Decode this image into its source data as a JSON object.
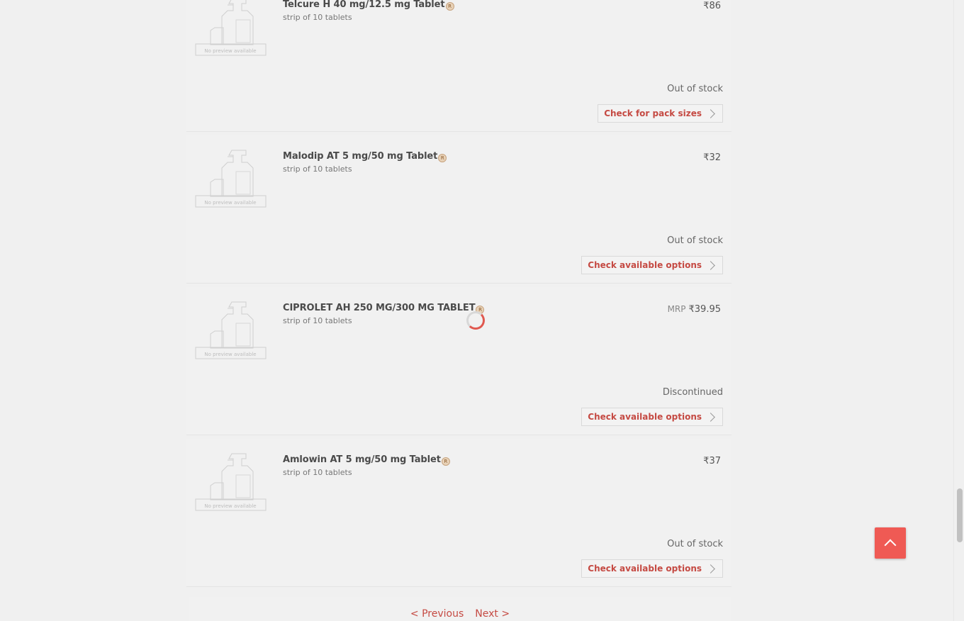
{
  "products": [
    {
      "name": "Telcure H 40 mg/12.5 mg Tablet",
      "pack": "strip of 10 tablets",
      "mrp_label": "",
      "price": "₹86",
      "status": "Out of stock",
      "cta": "Check for pack sizes",
      "thumb_text": "No preview available"
    },
    {
      "name": "Malodip AT 5 mg/50 mg Tablet",
      "pack": "strip of 10 tablets",
      "mrp_label": "",
      "price": "₹32",
      "status": "Out of stock",
      "cta": "Check available options",
      "thumb_text": "No preview available"
    },
    {
      "name": "CIPROLET AH 250 MG/300 MG TABLET",
      "pack": "strip of 10 tablets",
      "mrp_label": "MRP",
      "price": "₹39.95",
      "status": "Discontinued",
      "cta": "Check available options",
      "thumb_text": "No preview available"
    },
    {
      "name": "Amlowin AT 5 mg/50 mg Tablet",
      "pack": "strip of 10 tablets",
      "mrp_label": "",
      "price": "₹37",
      "status": "Out of stock",
      "cta": "Check available options",
      "thumb_text": "No preview available"
    }
  ],
  "rx_badge": "R",
  "pagination": {
    "previous": "< Previous",
    "next": "Next >"
  },
  "colors": {
    "accent": "#c54a43",
    "scroll_top_bg": "#ef5a54"
  },
  "icons": {
    "rx": "rx-icon",
    "chevron": "chevron-right-icon",
    "scroll_top": "chevron-up-icon",
    "spinner": "loading-spinner"
  }
}
